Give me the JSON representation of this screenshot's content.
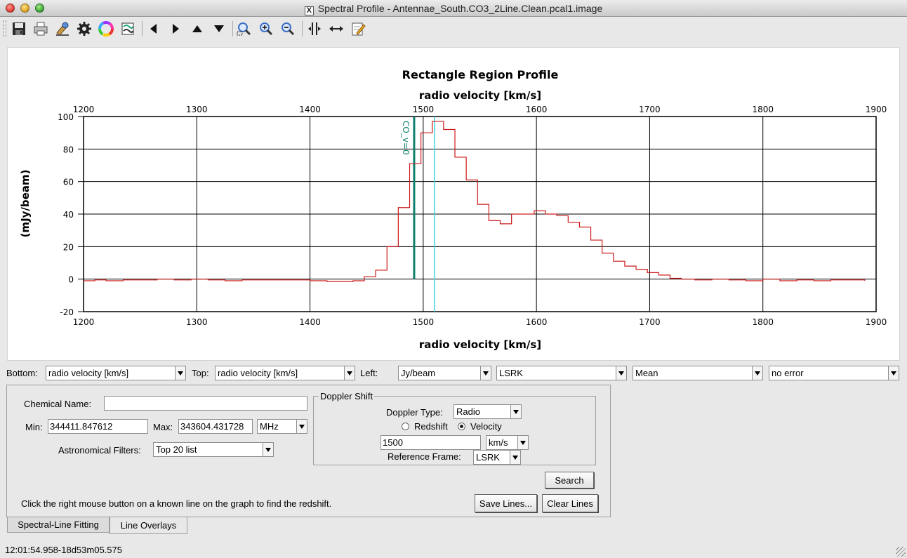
{
  "window": {
    "title": "Spectral Profile - Antennae_South.CO3_2Line.Clean.pcal1.image"
  },
  "toolbar": {
    "buttons": [
      "save-icon",
      "print-icon",
      "preferences-icon",
      "settings-gear-icon",
      "color-wheel-icon",
      "legend-icon",
      "arrow-left-icon",
      "arrow-right-icon",
      "arrow-up-icon",
      "arrow-down-icon",
      "zoom-range-icon",
      "zoom-in-icon",
      "zoom-out-icon",
      "range-select-icon",
      "horizontal-stretch-icon",
      "annotate-icon"
    ]
  },
  "chart_data": {
    "type": "line",
    "title": "Rectangle Region Profile",
    "xlabel": "radio velocity [km/s]",
    "x2label": "radio velocity [km/s]",
    "ylabel": "(mJy/beam)",
    "xlim": [
      1200,
      1900
    ],
    "ylim": [
      -20,
      100
    ],
    "xticks": [
      1200,
      1300,
      1400,
      1500,
      1600,
      1700,
      1800,
      1900
    ],
    "yticks": [
      -20,
      0,
      20,
      40,
      60,
      80,
      100
    ],
    "grid": true,
    "line_style": "step",
    "colors": {
      "profile": "#cc1a1a",
      "marker": "#0f7f6e",
      "reference": "#3fd4e4"
    },
    "annotations": [
      {
        "text": "CO_v=0",
        "x": 1492,
        "color": "#0f7f6e"
      }
    ],
    "reference_line_x": 1510,
    "series": [
      {
        "x": [
          1200,
          1210,
          1220,
          1235,
          1250,
          1265,
          1280,
          1295,
          1310,
          1325,
          1340,
          1355,
          1370,
          1385,
          1400,
          1415,
          1428,
          1438,
          1448,
          1458,
          1468,
          1478,
          1488,
          1498,
          1508,
          1518,
          1528,
          1538,
          1548,
          1558,
          1568,
          1578,
          1588,
          1598,
          1608,
          1618,
          1628,
          1638,
          1648,
          1658,
          1668,
          1678,
          1688,
          1698,
          1708,
          1718,
          1728,
          1740,
          1755,
          1770,
          1785,
          1800,
          1815,
          1830,
          1845,
          1860,
          1875,
          1890
        ],
        "values": [
          -1,
          -0.5,
          -1,
          -0.5,
          -0.5,
          0,
          -0.5,
          0,
          -0.5,
          -1,
          -0.5,
          -0.5,
          -0.5,
          -0.5,
          -1,
          -1.5,
          -1.5,
          -1,
          1.5,
          5.5,
          20,
          44,
          71,
          90,
          97,
          92,
          75,
          61,
          46,
          36,
          34,
          40,
          40,
          42,
          40,
          39,
          35,
          32,
          24,
          16,
          11,
          8,
          6,
          4,
          2.5,
          0.5,
          0,
          -0.5,
          0,
          -0.5,
          -1,
          0,
          -1,
          -0.5,
          -1,
          -0.5,
          -0.5,
          -1
        ]
      }
    ]
  },
  "axis_controls": {
    "bottom_label": "Bottom:",
    "bottom_value": "radio velocity [km/s]",
    "top_label": "Top:",
    "top_value": "radio velocity [km/s]",
    "left_label": "Left:",
    "left_value": "Jy/beam",
    "frame_value": "LSRK",
    "stat_value": "Mean",
    "error_value": "no error"
  },
  "line_overlays": {
    "chemical_name_label": "Chemical Name:",
    "chemical_name_value": "",
    "min_label": "Min:",
    "min_value": "344411.847612",
    "max_label": "Max:",
    "max_value": "343604.431728",
    "unit_value": "MHz",
    "filters_label": "Astronomical Filters:",
    "filters_value": "Top 20 list",
    "doppler": {
      "legend": "Doppler Shift",
      "type_label": "Doppler Type:",
      "type_value": "Radio",
      "redshift_label": "Redshift",
      "velocity_label": "Velocity",
      "selected": "Velocity",
      "value": "1500",
      "unit_value": "km/s",
      "frame_label": "Reference Frame:",
      "frame_value": "LSRK"
    },
    "search_label": "Search",
    "hint": "Click the right mouse button on a known line on the graph to find the redshift.",
    "save_lines_label": "Save Lines...",
    "clear_lines_label": "Clear Lines"
  },
  "tabs": [
    {
      "label": "Spectral-Line Fitting",
      "active": false
    },
    {
      "label": "Line Overlays",
      "active": true
    }
  ],
  "status": {
    "coordinates": "12:01:54.958-18d53m05.575"
  }
}
